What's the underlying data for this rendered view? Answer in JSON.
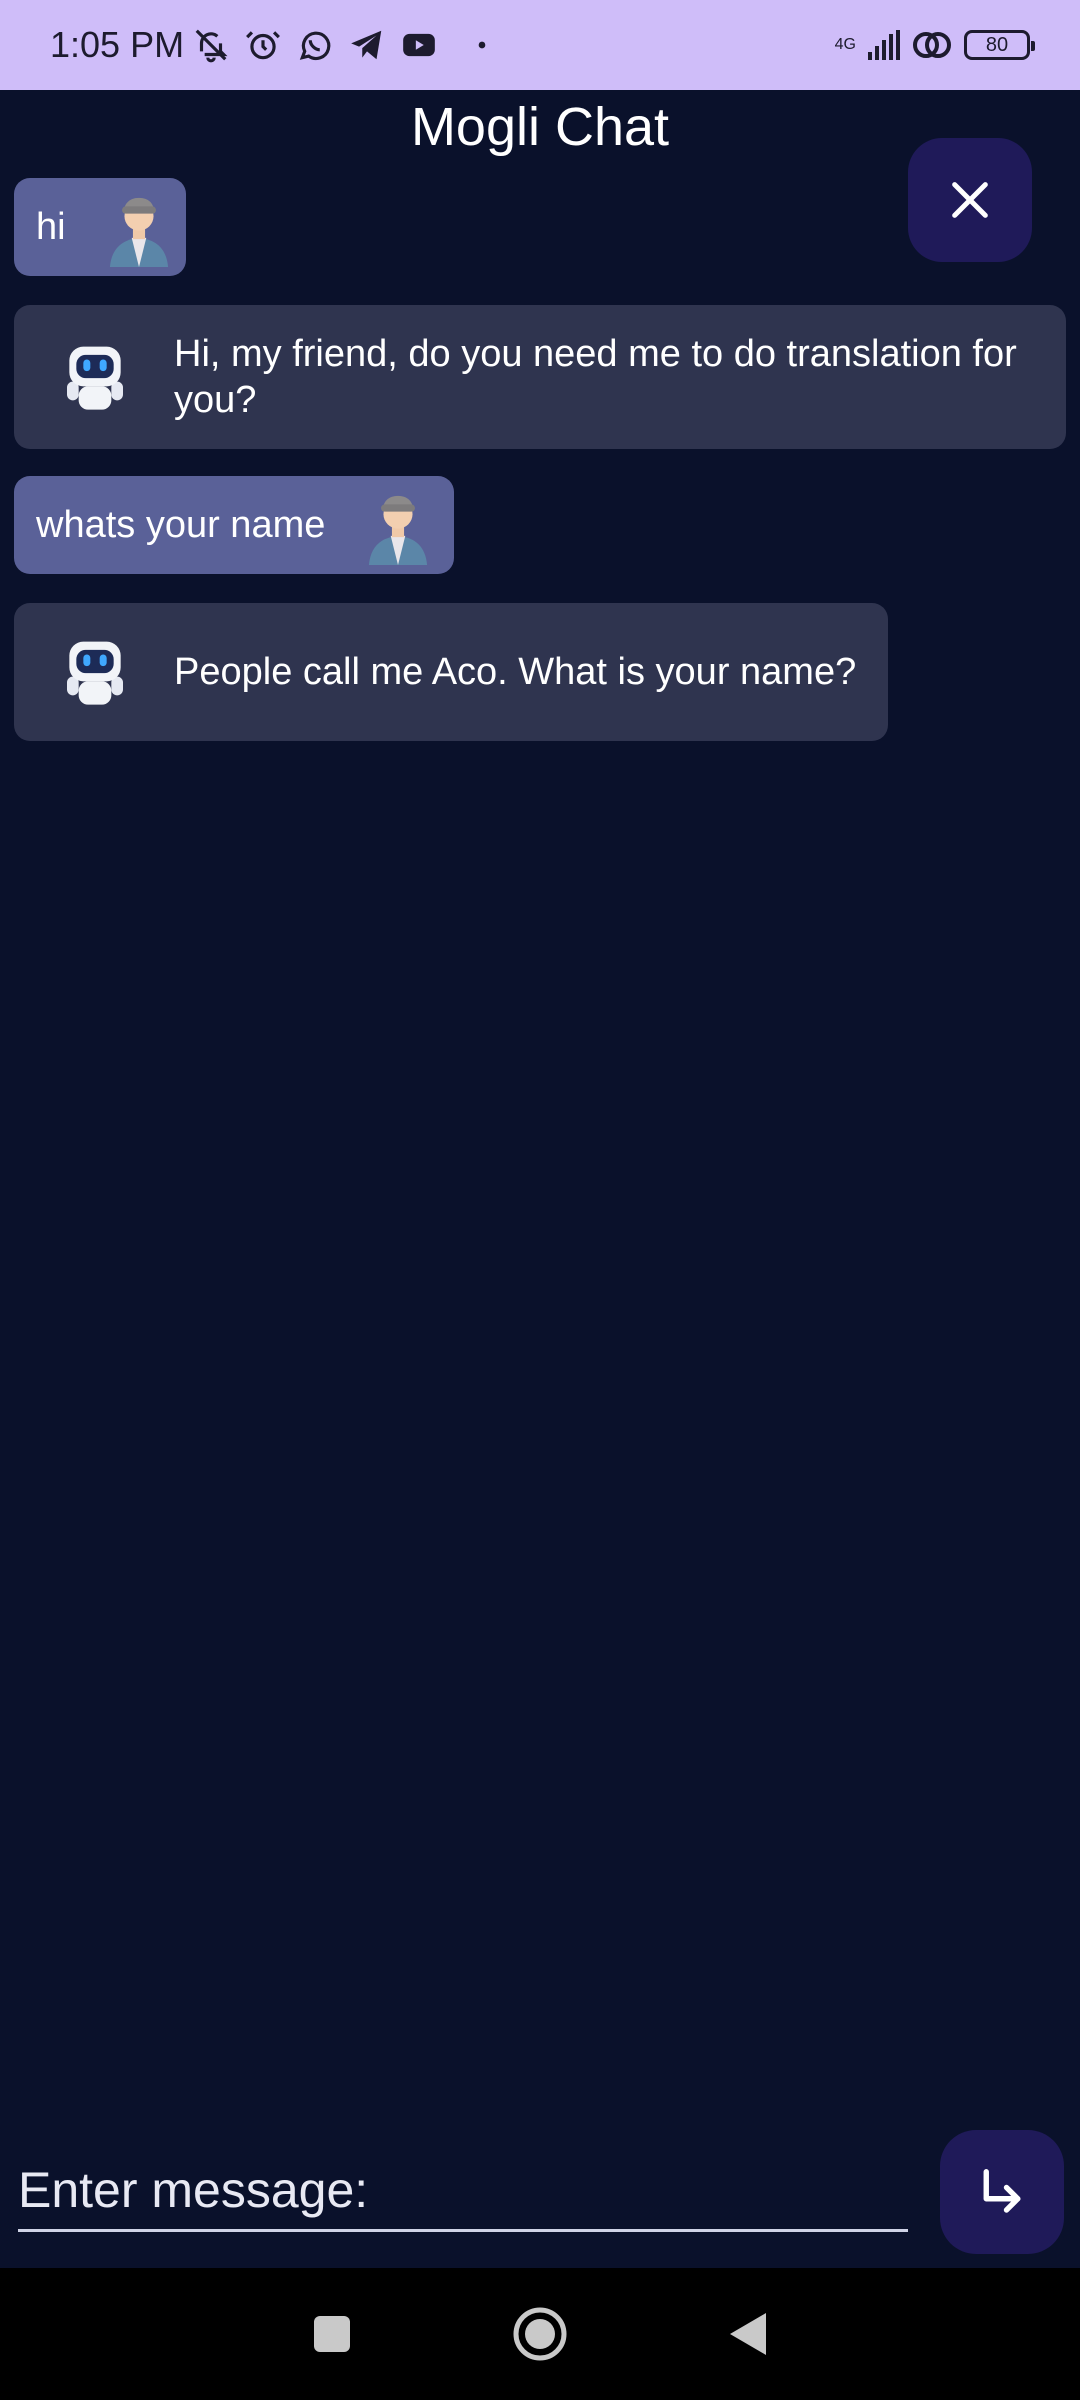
{
  "status_bar": {
    "time": "1:05 PM",
    "network": "4G",
    "battery": "80",
    "icons": [
      "bell-off-icon",
      "alarm-icon",
      "whatsapp-icon",
      "telegram-icon",
      "youtube-icon",
      "dot-icon",
      "signal-icon",
      "hotspot-icon",
      "battery-icon"
    ]
  },
  "header": {
    "title": "Mogli Chat"
  },
  "messages": [
    {
      "sender": "user",
      "text": "hi"
    },
    {
      "sender": "bot",
      "text": "Hi, my friend, do you need me to do translation for you?"
    },
    {
      "sender": "user",
      "text": "whats your name"
    },
    {
      "sender": "bot",
      "text": "People call me Aco. What is your name?"
    }
  ],
  "composer": {
    "placeholder": "Enter message:",
    "value": ""
  },
  "icons": {
    "close": "close-icon",
    "send": "send-arrow-icon"
  },
  "colors": {
    "background": "#0a112b",
    "status_bar": "#cfbdf9",
    "user_bubble": "#5a6198",
    "bot_bubble": "#2f344f",
    "action_button": "#1f1a59"
  }
}
